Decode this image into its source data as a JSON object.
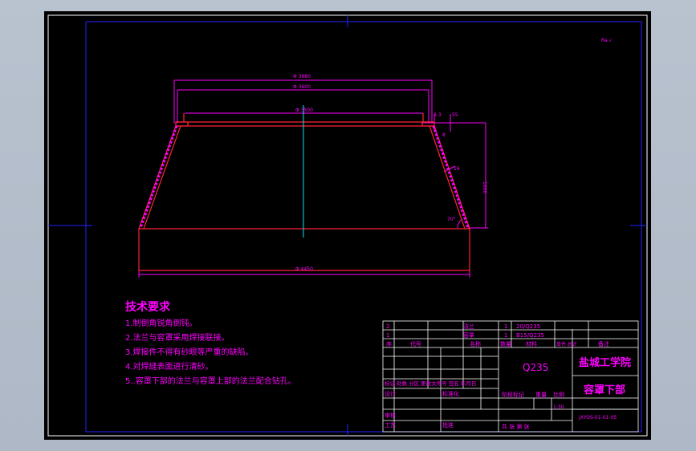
{
  "corner_mark": "Ra √",
  "dimensions": {
    "d_outer_top": "Φ 3680",
    "d_mid_top": "Φ 3600",
    "d_inner_top": "Φ 3500",
    "d_bottom": "Φ 4450",
    "height": "1000",
    "chamfer": "3.3",
    "small": "55",
    "edge": "8",
    "angle": "70°",
    "thickness": "16"
  },
  "tech_requirements": {
    "title": "技术要求",
    "items": [
      "1.制倒角锐角倒钝。",
      "2.法兰与容罩采用焊接联接。",
      "3.焊接件不得有砂眼等严重的缺陷。",
      "4.对焊缝表面进行清砂。",
      "5..容罩下部的法兰与容罩上部的法兰配合钻孔。"
    ]
  },
  "title_block": {
    "parts_rows": [
      {
        "no": "2",
        "name": "法兰",
        "qty": "1",
        "material": "20/Q235"
      },
      {
        "no": "1",
        "name": "容罩",
        "qty": "1",
        "material": "B15/Q235"
      }
    ],
    "header": {
      "no": "序",
      "code": "代号",
      "name": "名称",
      "qty": "数量",
      "material": "材料",
      "weight": "单件 总计",
      "remark": "备注"
    },
    "material": "Q235",
    "school": "盐城工学院",
    "part_name": "容罩下部",
    "scale": "1:30",
    "drawing_no": "JXYOS-01-01-05",
    "row_labels": {
      "label_a": "标记 处数 分区 更改文件号 签名 年月日",
      "label_design": "设计",
      "label_standard": "标准化",
      "label_stage": "阶段标记",
      "label_weight": "重量",
      "label_scale": "比例",
      "label_review": "审核",
      "label_process": "工艺",
      "label_approve": "批准",
      "label_sheets": "共  张  第  张"
    }
  }
}
